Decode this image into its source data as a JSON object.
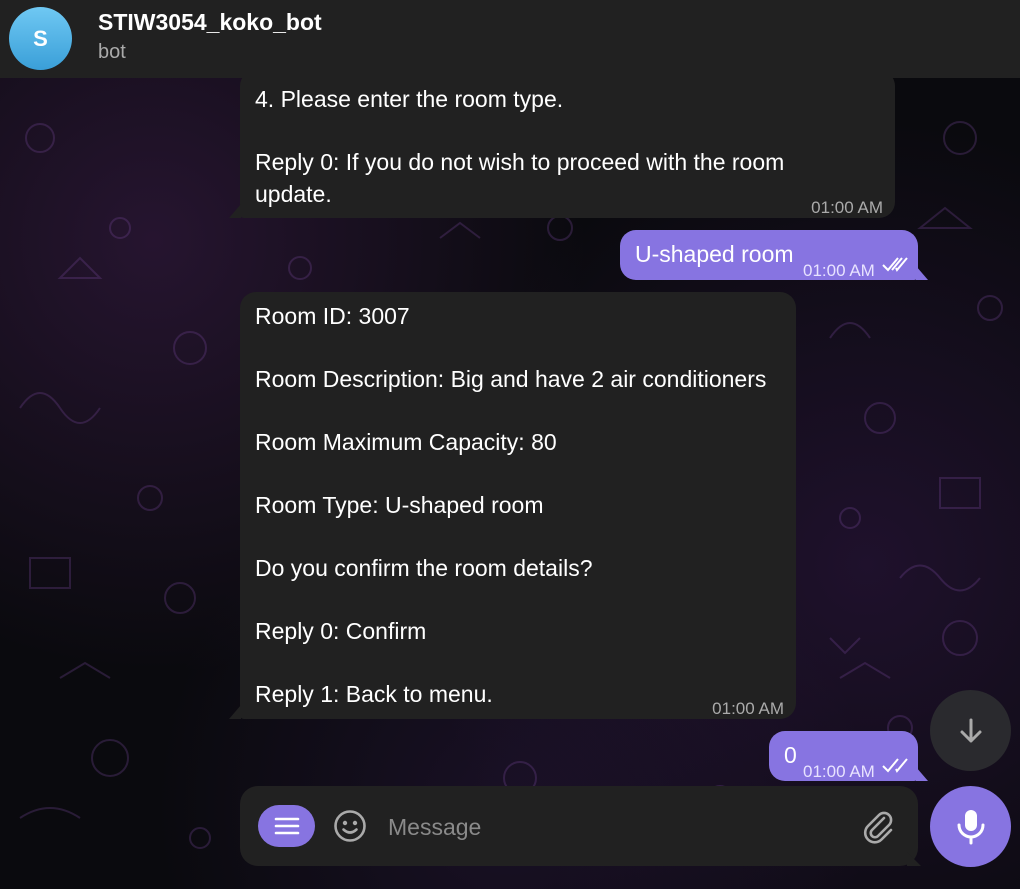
{
  "header": {
    "avatar_letter": "S",
    "title": "STIW3054_koko_bot",
    "subtitle": "bot"
  },
  "messages": [
    {
      "direction": "incoming",
      "lines": [
        "4. Please enter the room type.",
        "",
        "Reply 0: If you do not wish to proceed with the room",
        "update."
      ],
      "time": "01:00 AM"
    },
    {
      "direction": "outgoing",
      "lines": [
        "U-shaped room"
      ],
      "time": "01:00 AM",
      "read": true
    },
    {
      "direction": "incoming",
      "lines": [
        "Room ID: 3007",
        "",
        "Room Description: Big and have 2 air conditioners",
        "",
        "Room Maximum Capacity: 80",
        "",
        "Room Type: U-shaped room",
        "",
        "Do you confirm the room details?",
        "",
        "Reply 0: Confirm",
        "",
        "Reply 1: Back to menu."
      ],
      "time": "01:00 AM"
    },
    {
      "direction": "outgoing",
      "lines": [
        "0"
      ],
      "time": "01:00 AM",
      "read": true
    }
  ],
  "composer": {
    "placeholder": "Message",
    "value": ""
  },
  "icons": {
    "menu": "menu-icon",
    "emoji": "emoji-icon",
    "attach": "paperclip-icon",
    "mic": "microphone-icon",
    "scroll": "arrow-down-icon",
    "read": "double-check-icon"
  },
  "colors": {
    "accent": "#8774e1",
    "bubble_in": "#212121",
    "header": "#212121",
    "avatar": "#4aa8e0"
  }
}
